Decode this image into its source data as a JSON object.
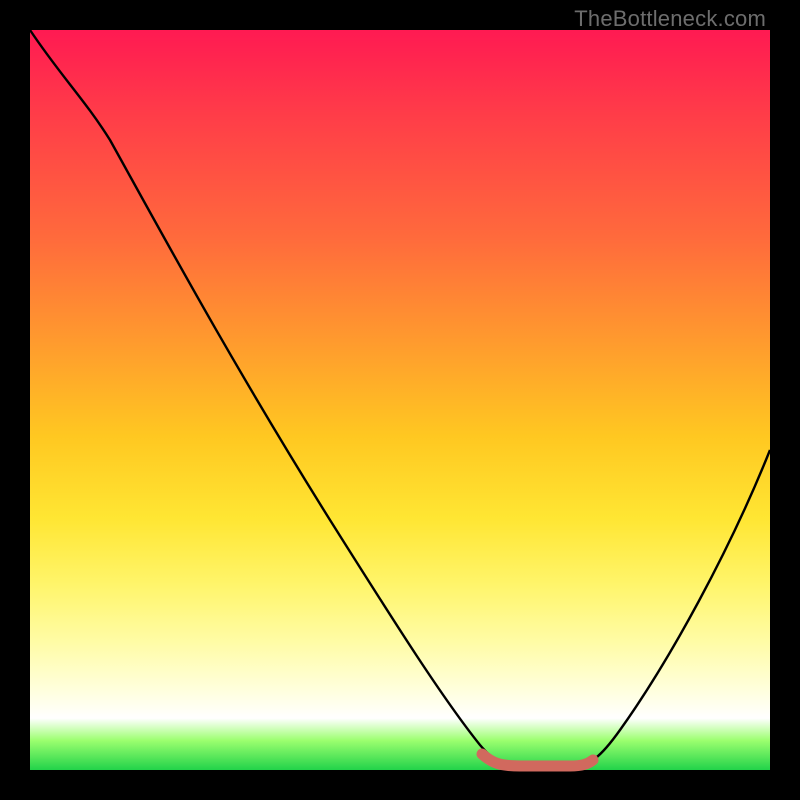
{
  "watermark": "TheBottleneck.com",
  "chart_data": {
    "type": "line",
    "title": "",
    "xlabel": "",
    "ylabel": "",
    "xlim": [
      0,
      100
    ],
    "ylim": [
      0,
      100
    ],
    "series": [
      {
        "name": "bottleneck-curve",
        "x": [
          0,
          5,
          10,
          15,
          20,
          25,
          30,
          35,
          40,
          45,
          50,
          55,
          60,
          62,
          65,
          68,
          70,
          72,
          75,
          80,
          85,
          90,
          95,
          100
        ],
        "y": [
          100,
          96,
          90,
          84,
          77,
          70,
          62,
          54,
          46,
          38,
          30,
          22,
          12,
          6,
          2,
          1,
          1,
          1,
          2,
          8,
          18,
          28,
          38,
          48
        ]
      },
      {
        "name": "optimal-flat-segment",
        "x": [
          62,
          65,
          68,
          70,
          72,
          74
        ],
        "y": [
          1.5,
          1,
          1,
          1,
          1,
          1.5
        ]
      }
    ],
    "colors": {
      "curve": "#000000",
      "flat_segment": "#d1695e",
      "gradient_top": "#ff1a52",
      "gradient_mid": "#ffe633",
      "gradient_bottom": "#22d34a"
    }
  }
}
